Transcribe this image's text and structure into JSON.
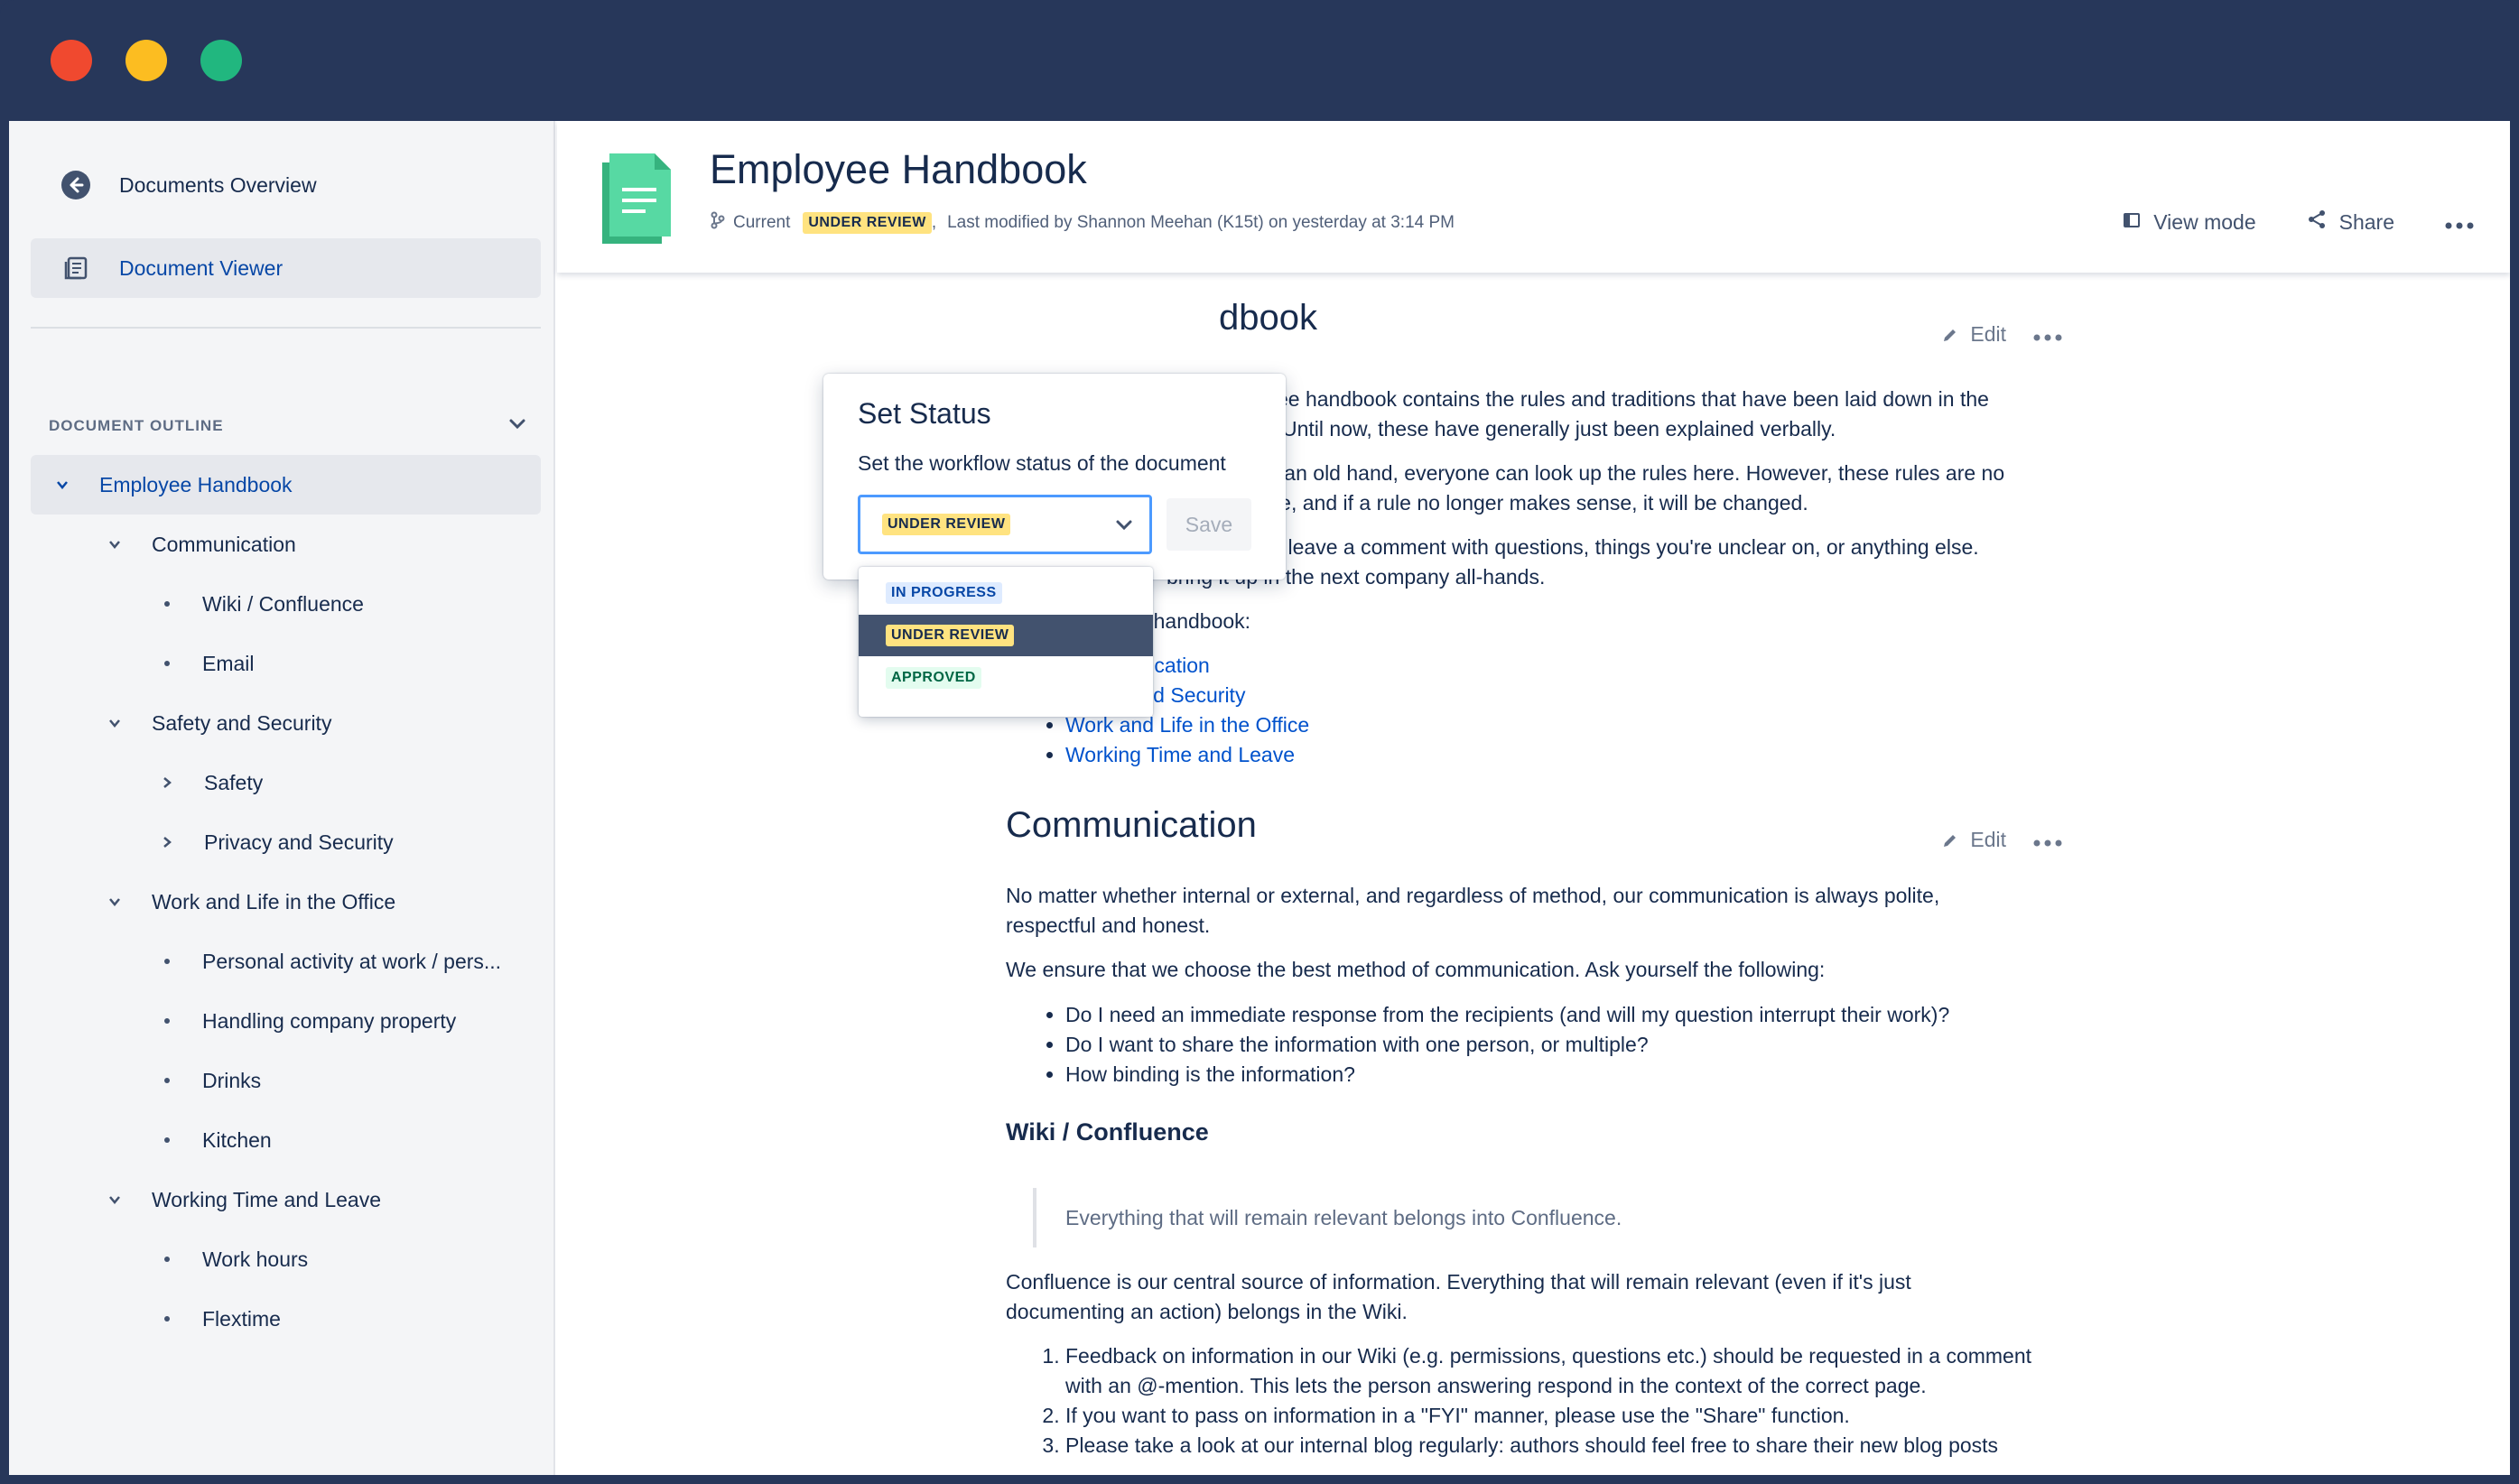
{
  "sidebar": {
    "back_label": "Documents Overview",
    "viewer_label": "Document Viewer",
    "outline_heading": "DOCUMENT OUTLINE",
    "tree": [
      {
        "label": "Employee Handbook",
        "level": 0
      },
      {
        "label": "Communication",
        "level": 1
      },
      {
        "label": "Wiki / Confluence",
        "level": 2
      },
      {
        "label": "Email",
        "level": 2
      },
      {
        "label": "Safety and Security",
        "level": 1
      },
      {
        "label": "Safety",
        "level": 2
      },
      {
        "label": "Privacy and Security",
        "level": 2
      },
      {
        "label": "Work and Life in the Office",
        "level": 1
      },
      {
        "label": "Personal activity at work / pers...",
        "level": 2
      },
      {
        "label": "Handling company property",
        "level": 2
      },
      {
        "label": "Drinks",
        "level": 2
      },
      {
        "label": "Kitchen",
        "level": 2
      },
      {
        "label": "Working Time and Leave",
        "level": 1
      },
      {
        "label": "Work hours",
        "level": 2
      },
      {
        "label": "Flextime",
        "level": 2
      }
    ]
  },
  "header": {
    "title": "Employee Handbook",
    "version_label": "Current",
    "status": "UNDER REVIEW",
    "separator": ",",
    "modified_text": "Last modified by Shannon Meehan (K15t) on yesterday at 3:14 PM",
    "view_mode_label": "View mode",
    "share_label": "Share"
  },
  "popup": {
    "title": "Set Status",
    "description": "Set the workflow status of the document",
    "selected": "UNDER REVIEW",
    "save_label": "Save",
    "options": [
      "IN PROGRESS",
      "UNDER REVIEW",
      "APPROVED"
    ]
  },
  "content": {
    "intro_heading_fragment": "dbook",
    "intro_p1_line1": "ee handbook contains the rules and traditions that have been laid down in the",
    "intro_p1_line2": "Until now, these have generally just been explained verbally.",
    "intro_p2_line1": "to the team or an old hand, everyone can look up the rules here. However, these rules are no",
    "intro_p2_line2": "common sense, and if a rule no longer makes sense, it will be changed.",
    "intro_p3_line1": "nd, please leave a comment with questions, things you're unclear on, or anything else.",
    "intro_p3_line2": "bring it up in the next company all-hands.",
    "structure_label": "Structure of the handbook:",
    "structure_links": [
      "Communication",
      "Safety and Security",
      "Work and Life in the Office",
      "Working Time and Leave"
    ],
    "edit_label": "Edit",
    "comm_heading": "Communication",
    "comm_p1": "No matter whether internal or external, and regardless of method, our communication is always polite, respectful and honest.",
    "comm_p2": "We ensure that we choose the best method of communication. Ask yourself the following:",
    "comm_questions": [
      "Do I need an immediate response from the recipients (and will my question interrupt their work)?",
      "Do I want to share the information with one person, or multiple?",
      "How binding is the information?"
    ],
    "wiki_heading": "Wiki / Confluence",
    "wiki_quote": "Everything that will remain relevant belongs into Confluence.",
    "wiki_p1": "Confluence is our central source of information. Everything that will remain relevant (even if it's just documenting an action) belongs in the Wiki.",
    "wiki_list": [
      "Feedback on information in our Wiki (e.g. permissions, questions etc.) should be requested in a comment with an @-mention. This lets the person answering respond in the context of the correct page.",
      "If you want to pass on information in a \"FYI\" manner, please use the \"Share\" function.",
      "Please take a look at our internal blog regularly: authors should feel free to share their new blog posts"
    ]
  }
}
